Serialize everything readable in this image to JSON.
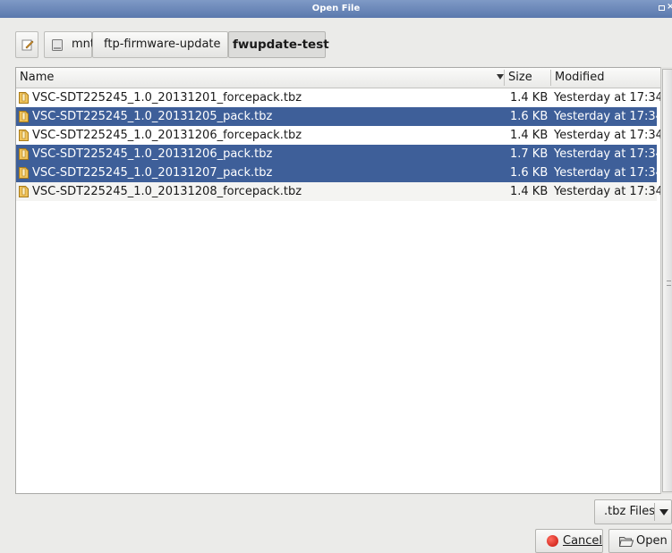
{
  "window": {
    "title": "Open File"
  },
  "pathbar": {
    "segments": [
      "mnt",
      "ftp-firmware-update",
      "fwupdate-test"
    ],
    "active_segment": "fwupdate-test"
  },
  "columns": {
    "name": "Name",
    "size": "Size",
    "modified": "Modified",
    "sort_column": "Name"
  },
  "files": [
    {
      "name": "VSC-SDT225245_1.0_20131201_forcepack.tbz",
      "size": "1.4 KB",
      "modified": "Yesterday at 17:34",
      "selected": false
    },
    {
      "name": "VSC-SDT225245_1.0_20131205_pack.tbz",
      "size": "1.6 KB",
      "modified": "Yesterday at 17:34",
      "selected": true
    },
    {
      "name": "VSC-SDT225245_1.0_20131206_forcepack.tbz",
      "size": "1.4 KB",
      "modified": "Yesterday at 17:34",
      "selected": false
    },
    {
      "name": "VSC-SDT225245_1.0_20131206_pack.tbz",
      "size": "1.7 KB",
      "modified": "Yesterday at 17:34",
      "selected": true
    },
    {
      "name": "VSC-SDT225245_1.0_20131207_pack.tbz",
      "size": "1.6 KB",
      "modified": "Yesterday at 17:34",
      "selected": true
    },
    {
      "name": "VSC-SDT225245_1.0_20131208_forcepack.tbz",
      "size": "1.4 KB",
      "modified": "Yesterday at 17:34",
      "selected": false
    }
  ],
  "filter": {
    "selected": ".tbz Files"
  },
  "buttons": {
    "cancel": "Cancel",
    "open": "Open"
  },
  "icons": {
    "edit": "pencil-icon",
    "drive": "drive-icon",
    "file": "archive-file-icon",
    "cancel": "stop-icon",
    "open": "folder-open-icon"
  },
  "colors": {
    "selection": "#3e5f99",
    "titlebar": "#6a87ba"
  }
}
